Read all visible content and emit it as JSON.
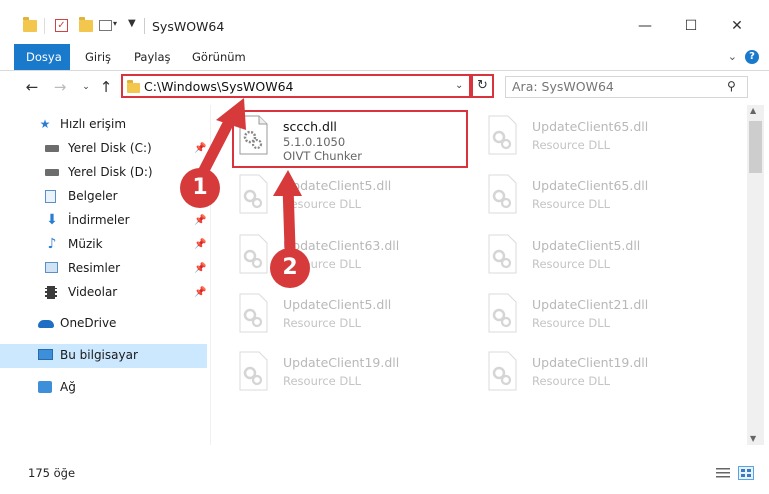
{
  "window": {
    "title": "SysWOW64",
    "minimize": "—",
    "maximize": "☐",
    "close": "✕"
  },
  "ribbon": {
    "tabs": [
      "Dosya",
      "Giriş",
      "Paylaş",
      "Görünüm"
    ],
    "help": "?"
  },
  "address": {
    "path": "C:\\Windows\\SysWOW64",
    "search_placeholder": "Ara: SysWOW64"
  },
  "sidebar": {
    "items": [
      {
        "label": "Hızlı erişim",
        "icon": "star-icon"
      },
      {
        "label": "Yerel Disk (C:)",
        "icon": "drive-icon",
        "pinned": true
      },
      {
        "label": "Yerel Disk (D:)",
        "icon": "drive-icon"
      },
      {
        "label": "Belgeler",
        "icon": "documents-icon"
      },
      {
        "label": "İndirmeler",
        "icon": "download-icon",
        "pinned": true
      },
      {
        "label": "Müzik",
        "icon": "music-icon",
        "pinned": true
      },
      {
        "label": "Resimler",
        "icon": "pictures-icon",
        "pinned": true
      },
      {
        "label": "Videolar",
        "icon": "videos-icon",
        "pinned": true
      },
      {
        "label": "OneDrive",
        "icon": "cloud-icon"
      },
      {
        "label": "Bu bilgisayar",
        "icon": "computer-icon",
        "selected": true
      },
      {
        "label": "Ağ",
        "icon": "network-icon"
      }
    ]
  },
  "files": [
    {
      "name": "sccch.dll",
      "version": "5.1.0.1050",
      "desc": "OIVT Chunker",
      "active": true
    },
    {
      "name": "UpdateClient65.dll",
      "desc": "Resource DLL"
    },
    {
      "name": "UpdateClient5.dll",
      "desc": "Resource DLL"
    },
    {
      "name": "UpdateClient65.dll",
      "desc": "Resource DLL"
    },
    {
      "name": "UpdateClient63.dll",
      "desc": "Resource DLL"
    },
    {
      "name": "UpdateClient5.dll",
      "desc": "Resource DLL"
    },
    {
      "name": "UpdateClient5.dll",
      "desc": "Resource DLL"
    },
    {
      "name": "UpdateClient21.dll",
      "desc": "Resource DLL"
    },
    {
      "name": "UpdateClient19.dll",
      "desc": "Resource DLL"
    },
    {
      "name": "UpdateClient19.dll",
      "desc": "Resource DLL"
    }
  ],
  "status": {
    "count": "175 öğe"
  },
  "annotations": {
    "badge1": "1",
    "badge2": "2",
    "color": "#d63a3a"
  },
  "colors": {
    "accent": "#1979ca",
    "highlight": "#d9343d",
    "selected_bg": "#cce8ff"
  }
}
